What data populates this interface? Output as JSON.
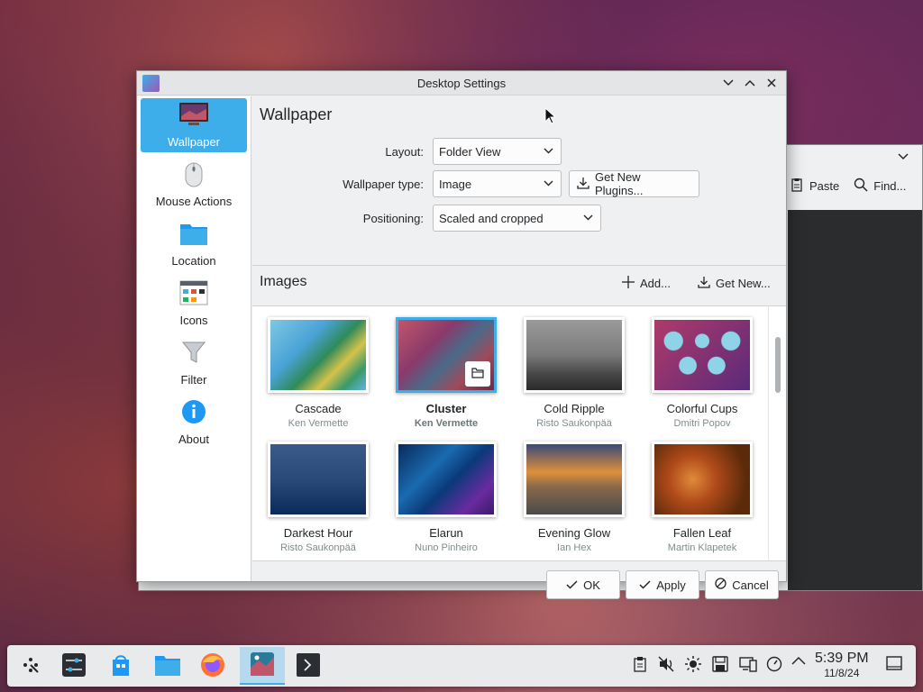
{
  "background_window": {
    "paste_label": "Paste",
    "find_label": "Find..."
  },
  "dialog": {
    "title": "Desktop Settings",
    "sidebar": {
      "items": [
        {
          "label": "Wallpaper",
          "icon": "monitor-icon"
        },
        {
          "label": "Mouse Actions",
          "icon": "mouse-icon"
        },
        {
          "label": "Location",
          "icon": "folder-icon"
        },
        {
          "label": "Icons",
          "icon": "icons-icon"
        },
        {
          "label": "Filter",
          "icon": "filter-icon"
        },
        {
          "label": "About",
          "icon": "info-icon"
        }
      ]
    },
    "wallpaper": {
      "section_title": "Wallpaper",
      "layout_label": "Layout:",
      "layout_value": "Folder View",
      "type_label": "Wallpaper type:",
      "type_value": "Image",
      "get_plugins_label": "Get New Plugins...",
      "positioning_label": "Positioning:",
      "positioning_value": "Scaled and cropped"
    },
    "images": {
      "header": "Images",
      "add_label": "Add...",
      "get_new_label": "Get New...",
      "tiles": [
        {
          "name": "Cascade",
          "author": "Ken Vermette"
        },
        {
          "name": "Cluster",
          "author": "Ken Vermette",
          "selected": true
        },
        {
          "name": "Cold Ripple",
          "author": "Risto Saukonpää"
        },
        {
          "name": "Colorful Cups",
          "author": "Dmitri Popov"
        },
        {
          "name": "Darkest Hour",
          "author": "Risto Saukonpää"
        },
        {
          "name": "Elarun",
          "author": "Nuno Pinheiro"
        },
        {
          "name": "Evening Glow",
          "author": "Ian Hex"
        },
        {
          "name": "Fallen Leaf",
          "author": "Martin Klapetek"
        }
      ]
    },
    "buttons": {
      "ok": "OK",
      "apply": "Apply",
      "cancel": "Cancel"
    }
  },
  "taskbar": {
    "time": "5:39 PM",
    "date": "11/8/24"
  },
  "colors": {
    "accent": "#3daee9",
    "window_bg": "#eff0f1"
  }
}
